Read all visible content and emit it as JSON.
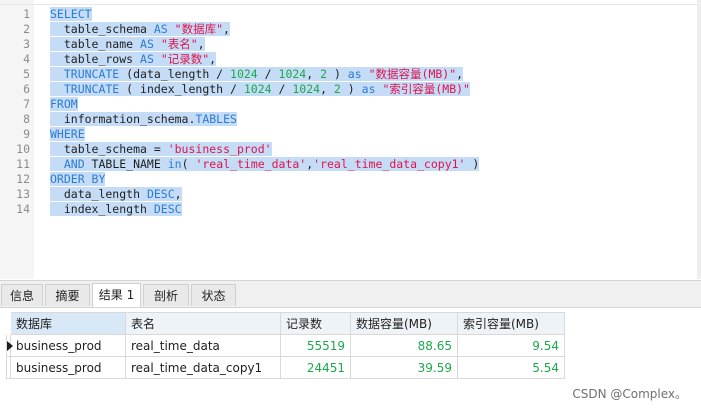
{
  "editor": {
    "lines": [
      {
        "n": "1",
        "parts": [
          [
            "kw",
            "SELECT"
          ]
        ]
      },
      {
        "n": "2",
        "parts": [
          [
            "txt",
            "  table_schema "
          ],
          [
            "kw",
            "AS"
          ],
          [
            "txt",
            " "
          ],
          [
            "str",
            "\"数据库\""
          ],
          [
            "txt",
            ","
          ]
        ]
      },
      {
        "n": "3",
        "parts": [
          [
            "txt",
            "  table_name "
          ],
          [
            "kw",
            "AS"
          ],
          [
            "txt",
            " "
          ],
          [
            "str",
            "\"表名\""
          ],
          [
            "txt",
            ","
          ]
        ]
      },
      {
        "n": "4",
        "parts": [
          [
            "txt",
            "  table_rows "
          ],
          [
            "kw",
            "AS"
          ],
          [
            "txt",
            " "
          ],
          [
            "str",
            "\"记录数\""
          ],
          [
            "txt",
            ","
          ]
        ]
      },
      {
        "n": "5",
        "parts": [
          [
            "kw",
            "  TRUNCATE"
          ],
          [
            "txt",
            " (data_length / "
          ],
          [
            "num",
            "1024"
          ],
          [
            "txt",
            " / "
          ],
          [
            "num",
            "1024"
          ],
          [
            "txt",
            ", "
          ],
          [
            "num",
            "2"
          ],
          [
            "txt",
            " ) "
          ],
          [
            "kw",
            "as"
          ],
          [
            "txt",
            " "
          ],
          [
            "str",
            "\"数据容量(MB)\""
          ],
          [
            "txt",
            ","
          ]
        ]
      },
      {
        "n": "6",
        "parts": [
          [
            "kw",
            "  TRUNCATE"
          ],
          [
            "txt",
            " ( index_length / "
          ],
          [
            "num",
            "1024"
          ],
          [
            "txt",
            " / "
          ],
          [
            "num",
            "1024"
          ],
          [
            "txt",
            ", "
          ],
          [
            "num",
            "2"
          ],
          [
            "txt",
            " ) "
          ],
          [
            "kw",
            "as"
          ],
          [
            "txt",
            " "
          ],
          [
            "str",
            "\"索引容量(MB)\""
          ]
        ]
      },
      {
        "n": "7",
        "parts": [
          [
            "kw",
            "FROM"
          ]
        ]
      },
      {
        "n": "8",
        "parts": [
          [
            "txt",
            "  information_schema."
          ],
          [
            "kw",
            "TABLES"
          ]
        ]
      },
      {
        "n": "9",
        "parts": [
          [
            "kw",
            "WHERE"
          ]
        ]
      },
      {
        "n": "10",
        "parts": [
          [
            "txt",
            "  table_schema = "
          ],
          [
            "str",
            "'business_prod'"
          ]
        ]
      },
      {
        "n": "11",
        "parts": [
          [
            "kw",
            "  AND"
          ],
          [
            "txt",
            " TABLE_NAME "
          ],
          [
            "kw",
            "in"
          ],
          [
            "txt",
            "( "
          ],
          [
            "str",
            "'real_time_data'"
          ],
          [
            "txt",
            ","
          ],
          [
            "str",
            "'real_time_data_copy1'"
          ],
          [
            "txt",
            " )"
          ]
        ]
      },
      {
        "n": "12",
        "parts": [
          [
            "kw",
            "ORDER BY"
          ]
        ]
      },
      {
        "n": "13",
        "parts": [
          [
            "txt",
            "  data_length "
          ],
          [
            "kw",
            "DESC"
          ],
          [
            "txt",
            ","
          ]
        ]
      },
      {
        "n": "14",
        "parts": [
          [
            "txt",
            "  index_length "
          ],
          [
            "kw",
            "DESC"
          ]
        ]
      }
    ]
  },
  "tabs": [
    {
      "label": "信息",
      "active": false
    },
    {
      "label": "摘要",
      "active": false
    },
    {
      "label": "结果 1",
      "active": true
    },
    {
      "label": "剖析",
      "active": false
    },
    {
      "label": "状态",
      "active": false
    }
  ],
  "grid": {
    "headers": [
      "数据库",
      "表名",
      "记录数",
      "数据容量(MB)",
      "索引容量(MB)"
    ],
    "rows": [
      [
        "business_prod",
        "real_time_data",
        "55519",
        "88.65",
        "9.54"
      ],
      [
        "business_prod",
        "real_time_data_copy1",
        "24451",
        "39.59",
        "5.54"
      ]
    ]
  },
  "watermark": "CSDN @Complex。"
}
